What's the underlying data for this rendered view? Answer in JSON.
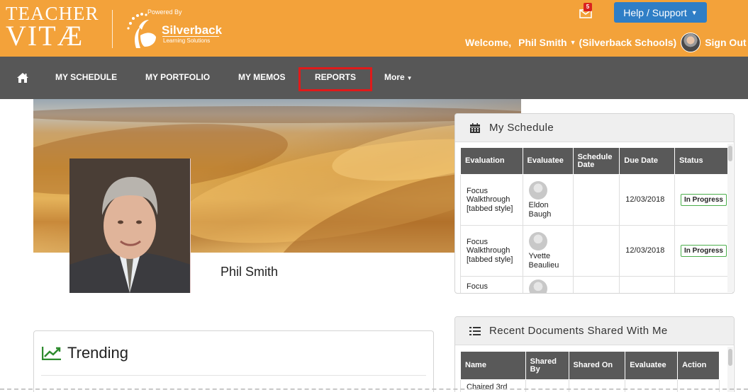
{
  "brand": {
    "logo_line1": "TEACHER",
    "logo_line2": "VITÆ",
    "powered_by": "Powered By",
    "partner_name": "Silverback",
    "partner_sub": "Learning Solutions"
  },
  "header": {
    "mail_count": "5",
    "help_label": "Help / Support",
    "welcome": "Welcome,",
    "user_name": "Phil Smith",
    "org": "(Silverback Schools)",
    "sign_out": "Sign Out"
  },
  "nav": {
    "items": [
      "MY SCHEDULE",
      "MY PORTFOLIO",
      "MY MEMOS",
      "REPORTS",
      "More"
    ],
    "highlight_color": "#e01a1a"
  },
  "profile": {
    "name": "Phil Smith"
  },
  "schedule": {
    "title": "My Schedule",
    "columns": [
      "Evaluation",
      "Evaluatee",
      "Schedule Date",
      "Due Date",
      "Status"
    ],
    "rows": [
      {
        "evaluation": "Focus Walkthrough [tabbed style]",
        "evaluatee": "Eldon Baugh",
        "schedule_date": "",
        "due_date": "12/03/2018",
        "status": "In Progress"
      },
      {
        "evaluation": "Focus Walkthrough [tabbed style]",
        "evaluatee": "Yvette Beaulieu",
        "schedule_date": "",
        "due_date": "12/03/2018",
        "status": "In Progress"
      },
      {
        "evaluation": "Focus",
        "evaluatee": "",
        "schedule_date": "",
        "due_date": "",
        "status": ""
      }
    ]
  },
  "documents": {
    "title": "Recent Documents Shared With Me",
    "columns": [
      "Name",
      "Shared By",
      "Shared On",
      "Evaluatee",
      "Action"
    ],
    "rows": [
      {
        "name": "Chaired 3rd"
      }
    ]
  },
  "trending": {
    "title": "Trending"
  },
  "colors": {
    "header_bg": "#f3a23a",
    "nav_bg": "#575757",
    "help_btn": "#2f7ec6",
    "status_border": "#4cae4c"
  }
}
